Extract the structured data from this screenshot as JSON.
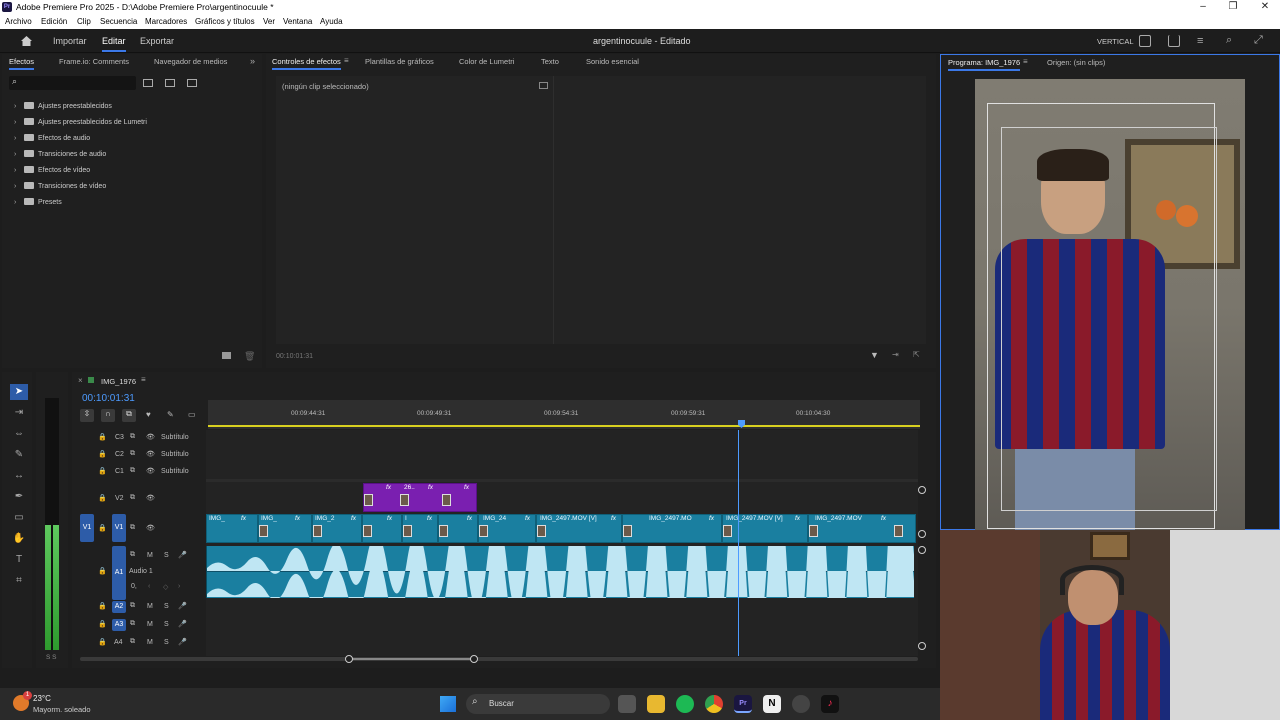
{
  "window": {
    "title": "Adobe Premiere Pro 2025 - D:\\Adobe Premiere Pro\\argentinocuule *",
    "app_icon": "Pr"
  },
  "menu": [
    "Archivo",
    "Edición",
    "Clip",
    "Secuencia",
    "Marcadores",
    "Gráficos y títulos",
    "Ver",
    "Ventana",
    "Ayuda"
  ],
  "header": {
    "home_icon": "home-icon",
    "import": "Importar",
    "edit": "Editar",
    "export": "Exportar",
    "project": "argentinocuule - Editado",
    "workspace": "VERTICAL"
  },
  "effects_panel": {
    "tabs": [
      "Efectos",
      "Frame.io: Comments",
      "Navegador de medios"
    ],
    "items": [
      "Ajustes preestablecidos",
      "Ajustes preestablecidos de Lumetri",
      "Efectos de audio",
      "Transiciones de audio",
      "Efectos de vídeo",
      "Transiciones de vídeo",
      "Presets"
    ]
  },
  "effect_controls": {
    "tabs": [
      "Controles de efectos",
      "Plantillas de gráficos",
      "Color de Lumetri",
      "Texto",
      "Sonido esencial"
    ],
    "empty": "(ningún clip seleccionado)",
    "timecode": "00:10:01:31"
  },
  "program": {
    "tabs": [
      "Programa: IMG_1976",
      "Origen: (sin clips)"
    ]
  },
  "timeline": {
    "sequence": "IMG_1976",
    "timecode": "00:10:01:31",
    "ruler": [
      "00:09:44:31",
      "00:09:49:31",
      "00:09:54:31",
      "00:09:59:31",
      "00:10:04:30"
    ],
    "subtitle_tracks": [
      {
        "id": "C3",
        "name": "Subtítulo"
      },
      {
        "id": "C2",
        "name": "Subtítulo"
      },
      {
        "id": "C1",
        "name": "Subtítulo"
      }
    ],
    "video_tracks": [
      "V2",
      "V1"
    ],
    "source_patch": "V1",
    "audio_tracks": [
      "A1",
      "A2",
      "A3",
      "A4"
    ],
    "audio1_name": "Audio 1",
    "audio1_value": "0,",
    "v2_clip_label": "26..",
    "v1_clips": [
      "IMG_",
      "IMG_",
      "IMG_2",
      "",
      "I",
      "",
      "IMG_24",
      "IMG_2497.MOV [V]",
      "IMG_2497.MO",
      "IMG_2497.MOV [V]",
      "IMG_2497.MOV"
    ],
    "meter_label": "S S"
  },
  "taskbar": {
    "temp": "23°C",
    "weather": "Mayorm. soleado",
    "search": "Buscar",
    "badge": "1"
  }
}
